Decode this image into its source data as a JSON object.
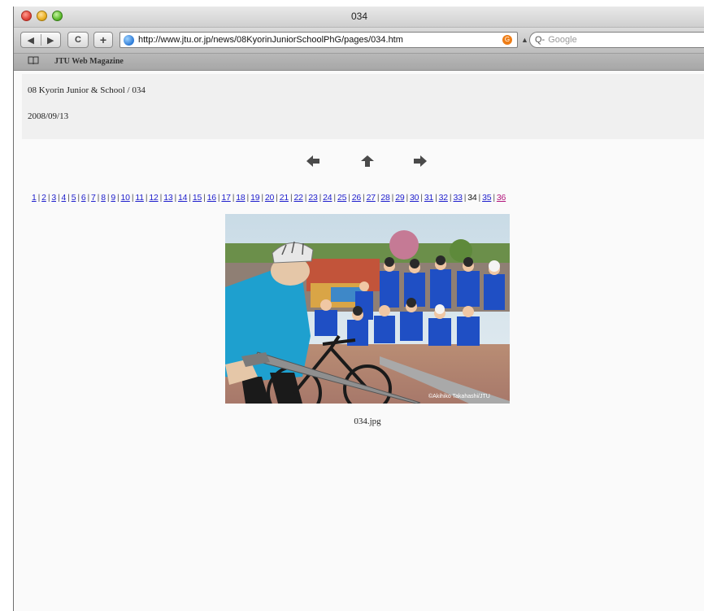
{
  "window": {
    "title": "034"
  },
  "toolbar": {
    "back_label": "◀",
    "forward_label": "▶",
    "reload_label": "C",
    "add_label": "+",
    "url": "http://www.jtu.or.jp/news/08KyorinJuniorSchoolPhG/pages/034.htm",
    "search_placeholder": "Google",
    "search_prefix": "Q-",
    "feed_label": "G"
  },
  "bookmarks": {
    "items": [
      {
        "label": "JTU Web Magazine"
      }
    ]
  },
  "page": {
    "heading": "08 Kyorin Junior & School / 034",
    "date": "2008/09/13",
    "nav": {
      "prev_icon": "arrow-left-icon",
      "index_icon": "arrow-up-icon",
      "next_icon": "arrow-right-icon"
    },
    "pages": [
      "1",
      "2",
      "3",
      "4",
      "5",
      "6",
      "7",
      "8",
      "9",
      "10",
      "11",
      "12",
      "13",
      "14",
      "15",
      "16",
      "17",
      "18",
      "19",
      "20",
      "21",
      "22",
      "23",
      "24",
      "25",
      "26",
      "27",
      "28",
      "29",
      "30",
      "31",
      "32",
      "33",
      "34",
      "35",
      "36"
    ],
    "current_page": "34",
    "visited_page": "36",
    "photo": {
      "caption": "034.jpg",
      "watermark": "©Akihiko Takahashi/JTU"
    }
  },
  "colors": {
    "link": "#1d1dcc",
    "visited_link": "#b1147a",
    "header_bg": "#f0f0f0"
  }
}
